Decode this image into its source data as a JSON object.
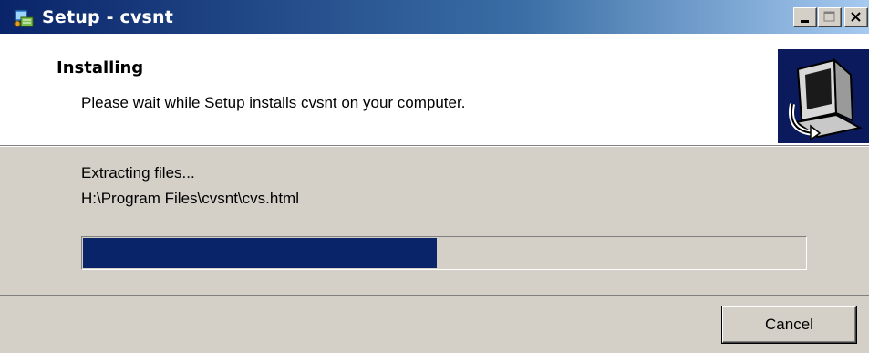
{
  "window": {
    "title": "Setup - cvsnt",
    "title_icon": "setup-installer-icon",
    "titlebar_gradient": [
      "#0a246a",
      "#a6caf0"
    ]
  },
  "header": {
    "title": "Installing",
    "subtitle": "Please wait while Setup installs cvsnt on your computer.",
    "image": "computer-install-icon",
    "image_background": "#0b1a5c"
  },
  "body": {
    "status": "Extracting files...",
    "current_file": "H:\\Program Files\\cvsnt\\cvs.html",
    "progress_fraction": 0.49,
    "progress_color": "#0a246a"
  },
  "buttons": {
    "cancel_label": "Cancel"
  }
}
